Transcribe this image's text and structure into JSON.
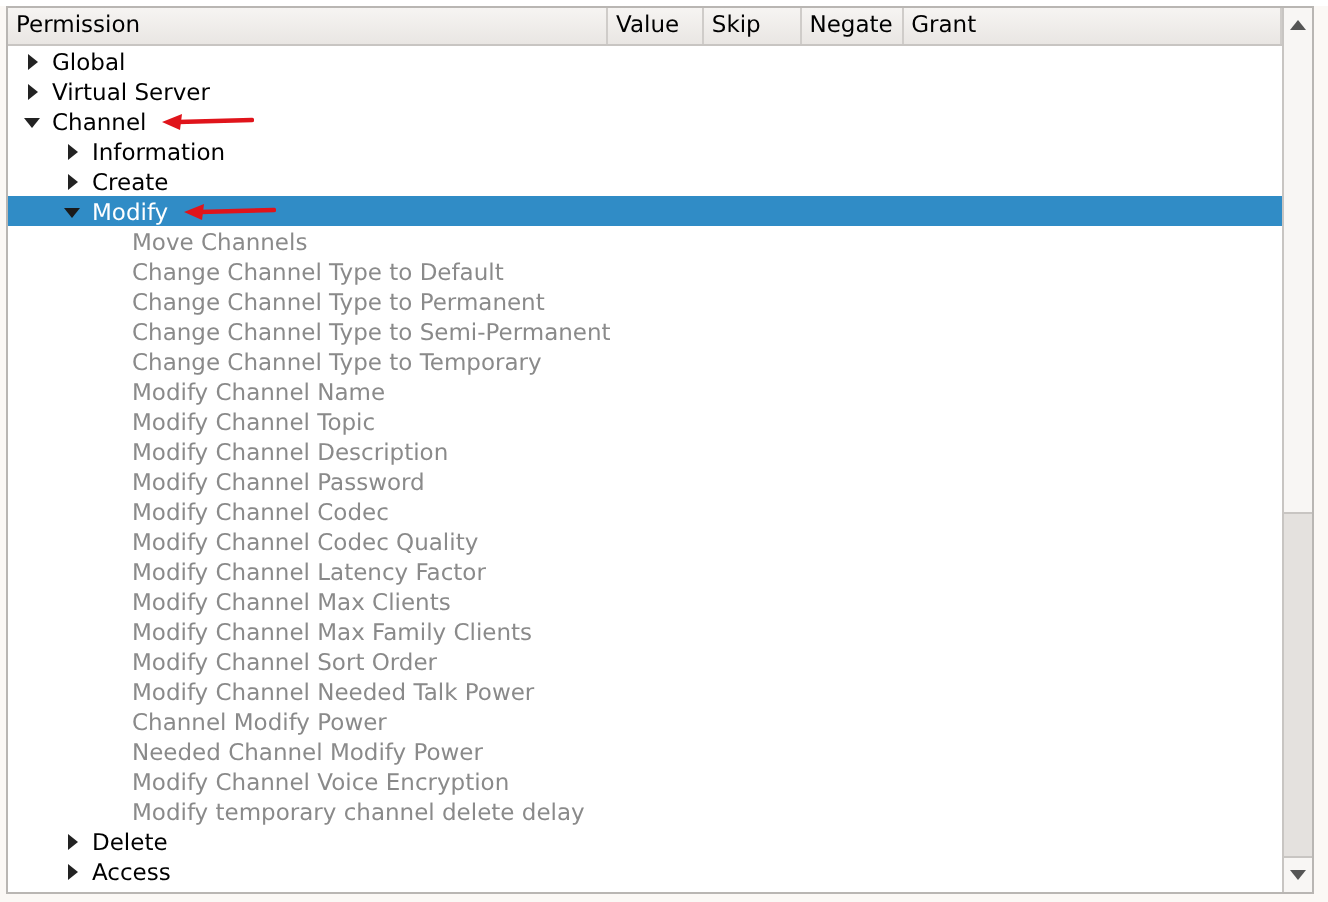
{
  "table": {
    "columns": [
      "Permission",
      "Value",
      "Skip",
      "Negate",
      "Grant"
    ],
    "tree": [
      {
        "label": "Global",
        "kind": "group",
        "expanded": false,
        "selected": false,
        "annotated": false
      },
      {
        "label": "Virtual Server",
        "kind": "group",
        "expanded": false,
        "selected": false,
        "annotated": false
      },
      {
        "label": "Channel",
        "kind": "group",
        "expanded": true,
        "selected": false,
        "annotated": true,
        "children": [
          {
            "label": "Information",
            "kind": "group",
            "expanded": false,
            "selected": false,
            "annotated": false
          },
          {
            "label": "Create",
            "kind": "group",
            "expanded": false,
            "selected": false,
            "annotated": false
          },
          {
            "label": "Modify",
            "kind": "group",
            "expanded": true,
            "selected": true,
            "annotated": true,
            "children": [
              {
                "label": "Move Channels",
                "kind": "permission",
                "disabled": true
              },
              {
                "label": "Change Channel Type to Default",
                "kind": "permission",
                "disabled": true
              },
              {
                "label": "Change Channel Type to Permanent",
                "kind": "permission",
                "disabled": true
              },
              {
                "label": "Change Channel Type to Semi-Permanent",
                "kind": "permission",
                "disabled": true
              },
              {
                "label": "Change Channel Type to Temporary",
                "kind": "permission",
                "disabled": true
              },
              {
                "label": "Modify Channel Name",
                "kind": "permission",
                "disabled": true
              },
              {
                "label": "Modify Channel Topic",
                "kind": "permission",
                "disabled": true
              },
              {
                "label": "Modify Channel Description",
                "kind": "permission",
                "disabled": true
              },
              {
                "label": "Modify Channel Password",
                "kind": "permission",
                "disabled": true
              },
              {
                "label": "Modify Channel Codec",
                "kind": "permission",
                "disabled": true
              },
              {
                "label": "Modify Channel Codec Quality",
                "kind": "permission",
                "disabled": true
              },
              {
                "label": "Modify Channel Latency Factor",
                "kind": "permission",
                "disabled": true
              },
              {
                "label": "Modify Channel Max Clients",
                "kind": "permission",
                "disabled": true
              },
              {
                "label": "Modify Channel Max Family Clients",
                "kind": "permission",
                "disabled": true
              },
              {
                "label": "Modify Channel Sort Order",
                "kind": "permission",
                "disabled": true
              },
              {
                "label": "Modify Channel Needed Talk Power",
                "kind": "permission",
                "disabled": true
              },
              {
                "label": "Channel Modify Power",
                "kind": "permission",
                "disabled": true
              },
              {
                "label": "Needed Channel Modify Power",
                "kind": "permission",
                "disabled": true
              },
              {
                "label": "Modify Channel Voice Encryption",
                "kind": "permission",
                "disabled": true
              },
              {
                "label": "Modify temporary channel delete delay",
                "kind": "permission",
                "disabled": true
              }
            ]
          },
          {
            "label": "Delete",
            "kind": "group",
            "expanded": false,
            "selected": false,
            "annotated": false
          },
          {
            "label": "Access",
            "kind": "group",
            "expanded": false,
            "selected": false,
            "annotated": false
          }
        ]
      }
    ]
  }
}
